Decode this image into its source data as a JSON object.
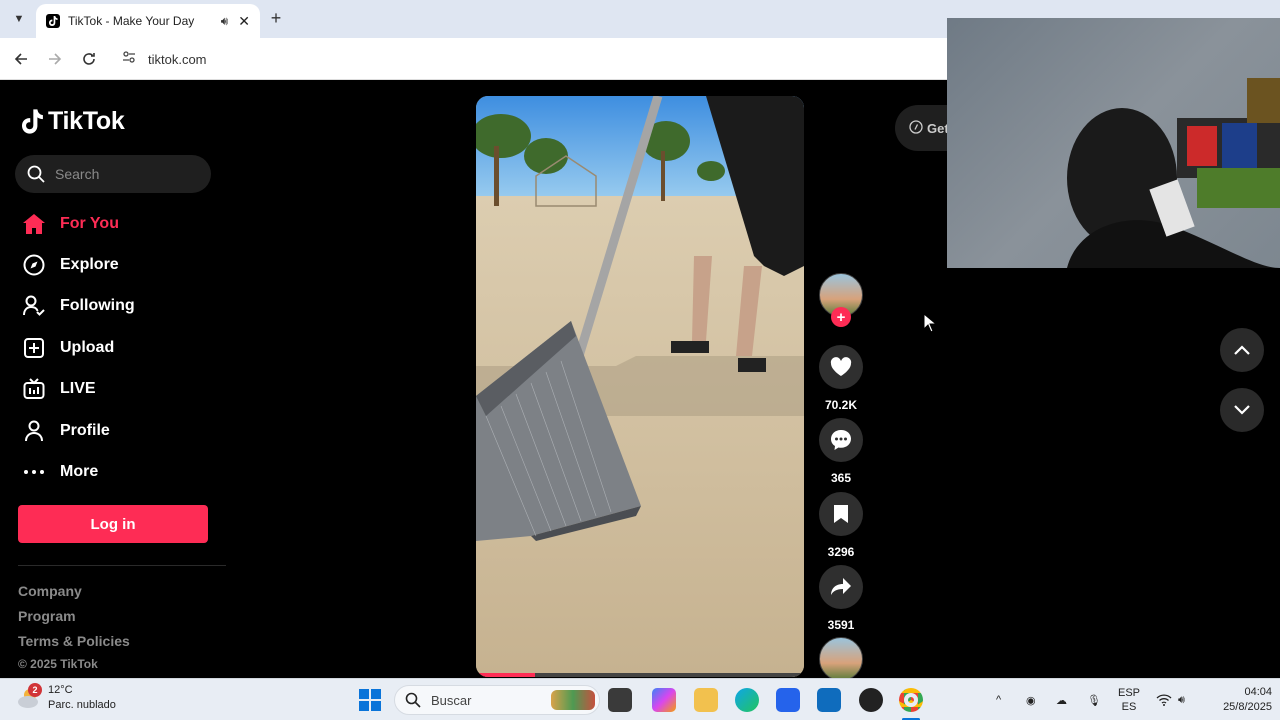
{
  "browser": {
    "tab_title": "TikTok - Make Your Day",
    "url": "tiktok.com"
  },
  "sidebar": {
    "logo": "TikTok",
    "search_placeholder": "Search",
    "items": [
      {
        "label": "For You",
        "icon": "home-icon",
        "active": true
      },
      {
        "label": "Explore",
        "icon": "compass-icon"
      },
      {
        "label": "Following",
        "icon": "following-icon"
      },
      {
        "label": "Upload",
        "icon": "upload-icon"
      },
      {
        "label": "LIVE",
        "icon": "live-tv-icon"
      },
      {
        "label": "Profile",
        "icon": "profile-icon"
      },
      {
        "label": "More",
        "icon": "more-dots-icon"
      }
    ],
    "login_label": "Log in",
    "footer_links": [
      "Company",
      "Program",
      "Terms & Policies"
    ],
    "copyright": "© 2025 TikTok"
  },
  "video": {
    "progress": 0.18
  },
  "actions": {
    "likes": "70.2K",
    "comments": "365",
    "saves": "3296",
    "shares": "3591"
  },
  "get_app_label": "Get",
  "taskbar": {
    "weather_temp": "12°C",
    "weather_desc": "Parc. nublado",
    "weather_badge": "2",
    "search_label": "Buscar",
    "lang_top": "ESP",
    "lang_bottom": "ES",
    "time": "04:04",
    "date": "25/8/2025"
  },
  "colors": {
    "brand": "#fe2c55",
    "background": "#000000"
  }
}
